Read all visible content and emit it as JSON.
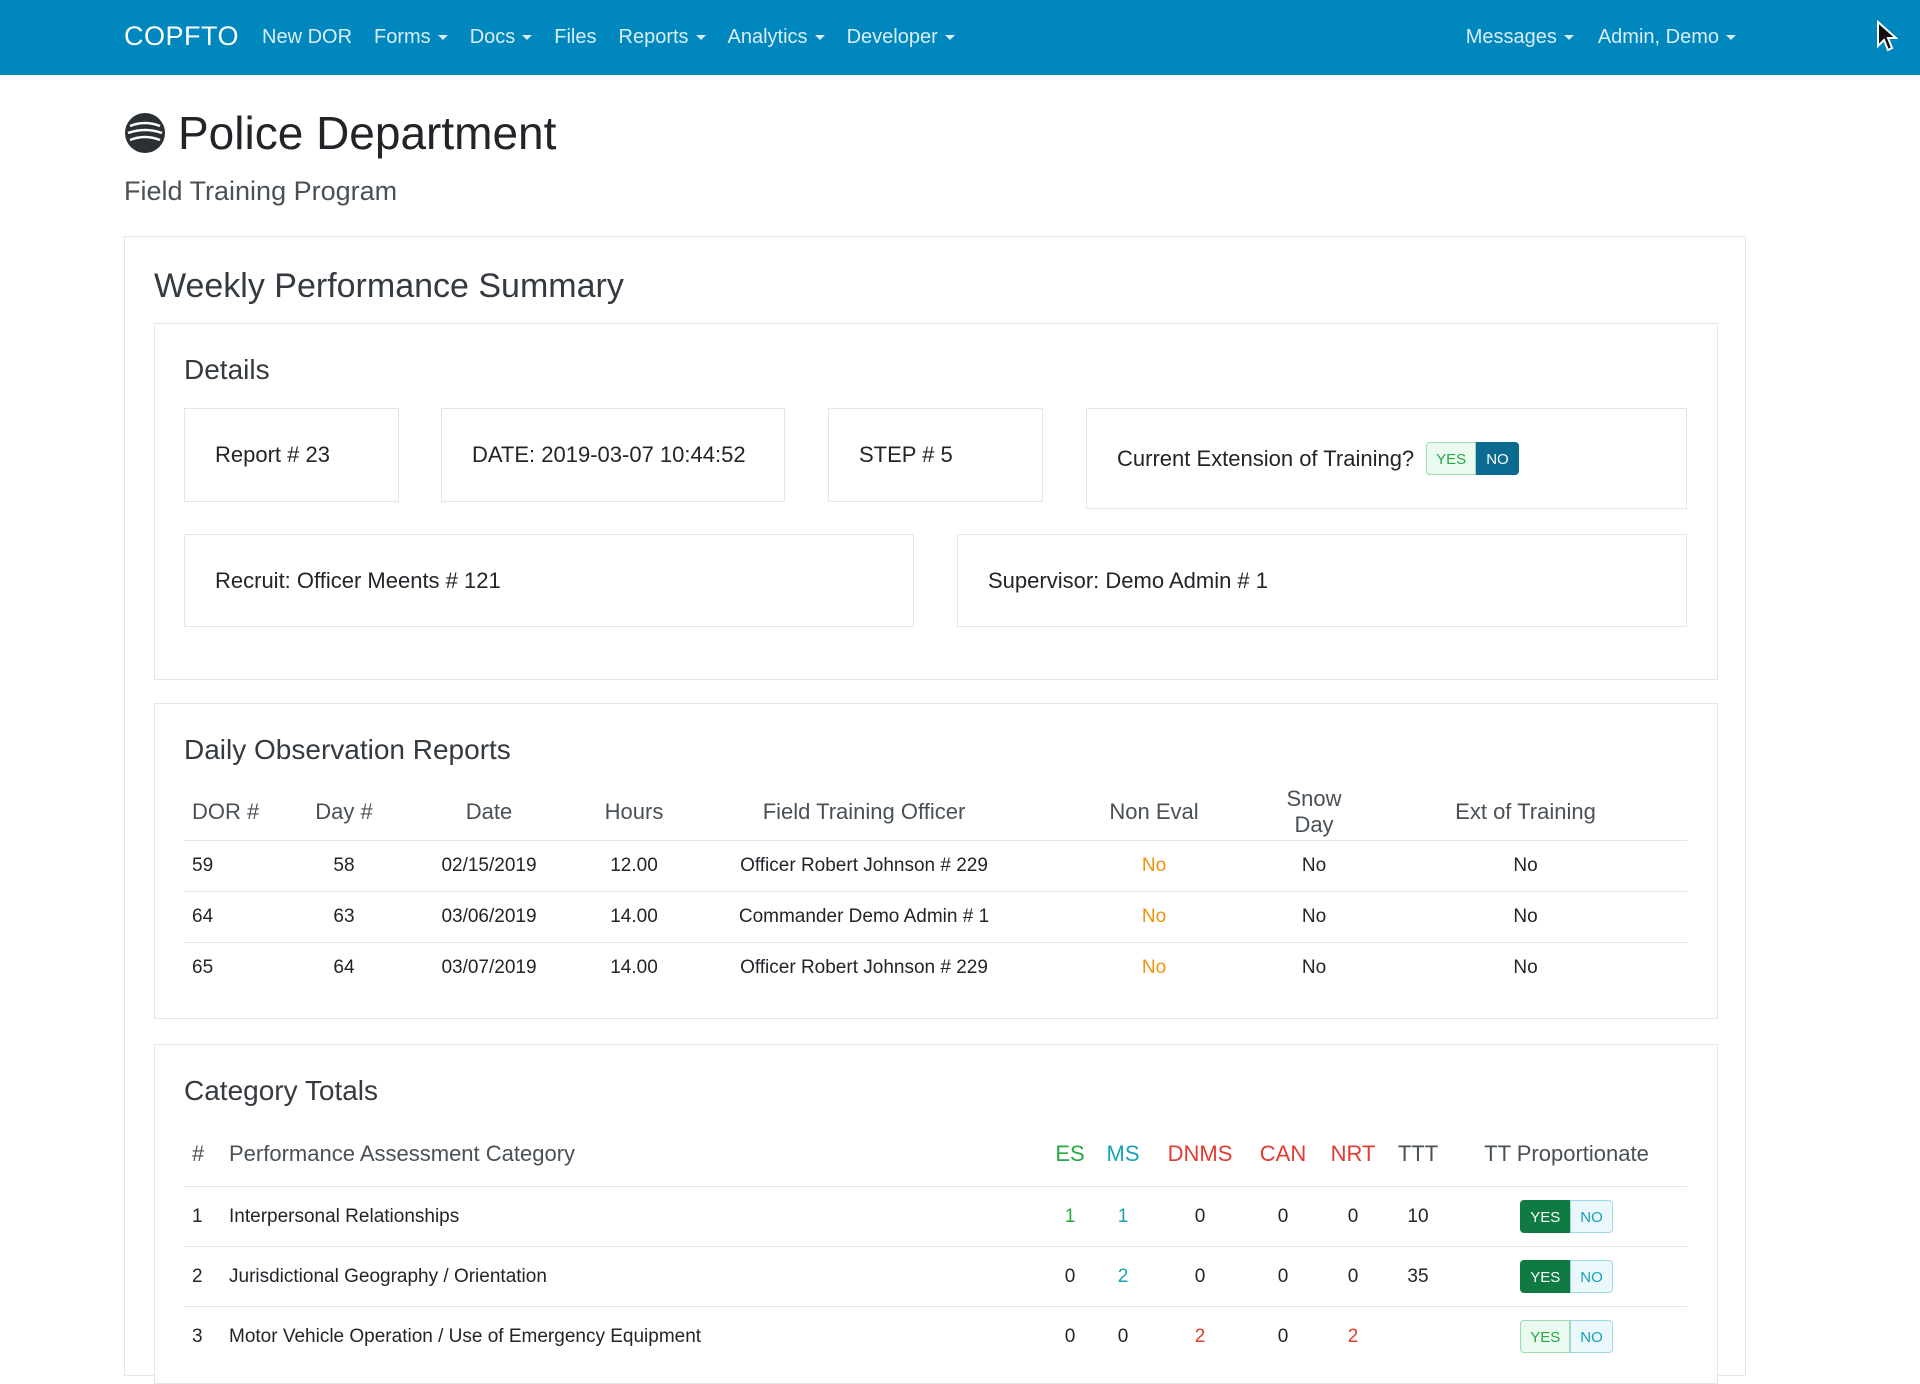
{
  "navbar": {
    "brand": "COPFTO",
    "items": [
      {
        "label": "New DOR"
      },
      {
        "label": "Forms"
      },
      {
        "label": "Docs"
      },
      {
        "label": "Files"
      },
      {
        "label": "Reports"
      },
      {
        "label": "Analytics"
      },
      {
        "label": "Developer"
      }
    ],
    "right_items": [
      {
        "label": "Messages"
      },
      {
        "label": "Admin, Demo"
      }
    ]
  },
  "header": {
    "title": "Police Department",
    "subtitle": "Field Training Program"
  },
  "summary": {
    "title": "Weekly Performance Summary",
    "details": {
      "title": "Details",
      "report": "Report # 23",
      "date": "DATE: 2019-03-07 10:44:52",
      "step": "STEP # 5",
      "extension_label": "Current Extension of Training?",
      "yes": "YES",
      "no": "NO",
      "recruit": "Recruit: Officer Meents # 121",
      "supervisor": "Supervisor: Demo Admin # 1"
    },
    "dor": {
      "title": "Daily Observation Reports",
      "columns": [
        "DOR #",
        "Day #",
        "Date",
        "Hours",
        "Field Training Officer",
        "Non Eval",
        "Snow Day",
        "Ext of Training"
      ],
      "rows": [
        [
          "59",
          "58",
          "02/15/2019",
          "12.00",
          "Officer Robert Johnson # 229",
          "No",
          "No",
          "No"
        ],
        [
          "64",
          "63",
          "03/06/2019",
          "14.00",
          "Commander Demo Admin # 1",
          "No",
          "No",
          "No"
        ],
        [
          "65",
          "64",
          "03/07/2019",
          "14.00",
          "Officer Robert Johnson # 229",
          "No",
          "No",
          "No"
        ]
      ]
    },
    "categories": {
      "title": "Category Totals",
      "columns": [
        "#",
        "Performance Assessment Category",
        "ES",
        "MS",
        "DNMS",
        "CAN",
        "NRT",
        "TTT",
        "TT Proportionate"
      ],
      "rows": [
        {
          "num": "1",
          "name": "Interpersonal Relationships",
          "es": "1",
          "ms": "1",
          "dnms": "0",
          "can": "0",
          "nrt": "0",
          "ttt": "10",
          "proportionate": "YES"
        },
        {
          "num": "2",
          "name": "Jurisdictional Geography / Orientation",
          "es": "0",
          "ms": "2",
          "dnms": "0",
          "can": "0",
          "nrt": "0",
          "ttt": "35",
          "proportionate": "YES"
        },
        {
          "num": "3",
          "name": "Motor Vehicle Operation / Use of Emergency Equipment",
          "es": "0",
          "ms": "0",
          "dnms": "2",
          "can": "0",
          "nrt": "2",
          "ttt": "",
          "proportionate": "NO"
        }
      ],
      "yes": "YES",
      "no": "NO"
    }
  },
  "colors": {
    "navbar": "#0087bd",
    "es": "#28a745",
    "ms": "#17a2b8",
    "alert": "#e23b2f",
    "warning": "#f0920a"
  }
}
